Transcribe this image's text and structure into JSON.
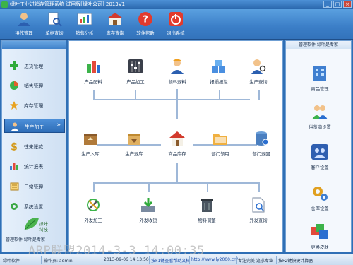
{
  "window": {
    "title": "绿叶工业进销存管理系统  试用版[绿叶公司]  2013V1",
    "minimize": "_",
    "maximize": "□",
    "close": "×"
  },
  "toolbar": {
    "items": [
      {
        "label": "操作管理",
        "icon": "user-manage-icon"
      },
      {
        "label": "单据查询",
        "icon": "document-search-icon"
      },
      {
        "label": "销售分析",
        "icon": "sales-analysis-icon"
      },
      {
        "label": "库存查询",
        "icon": "warehouse-icon"
      },
      {
        "label": "软件帮助",
        "icon": "help-icon"
      },
      {
        "label": "退出系统",
        "icon": "exit-icon"
      }
    ]
  },
  "sidebar": {
    "items": [
      {
        "label": "进货管理",
        "icon": "plus-icon",
        "color": "#2faa3a"
      },
      {
        "label": "销售管理",
        "icon": "pie-icon",
        "color": "#e2602c"
      },
      {
        "label": "库存管理",
        "icon": "star-icon",
        "color": "#e8a21f"
      },
      {
        "label": "生产加工",
        "icon": "user-icon",
        "color": "#ffffff",
        "active": true,
        "chevron": "»"
      },
      {
        "label": "往来账款",
        "icon": "dollar-icon",
        "color": "#d39a1b"
      },
      {
        "label": "统计报表",
        "icon": "bar-chart-icon",
        "color": "#3f7fd0"
      },
      {
        "label": "日常管理",
        "icon": "notebook-icon",
        "color": "#e1a321"
      },
      {
        "label": "系统设置",
        "icon": "gear-icon",
        "color": "#3ba845"
      }
    ],
    "logo_text": "绿叶科技",
    "caption": "管理软件 绿叶是专家"
  },
  "main": {
    "row1": [
      "产品配料",
      "产品加工",
      "领料退料",
      "报损报溢",
      "生产查询"
    ],
    "row2": [
      "生产入库",
      "生产退库",
      "商品库存",
      "部门领用",
      "部门退回"
    ],
    "row3": [
      "外发加工",
      "外发收货",
      "物料调整",
      "外发查询"
    ]
  },
  "right_panel": {
    "header": "管理软件 绿叶是专家",
    "items": [
      {
        "label": "商品管理",
        "icon": "building-icon"
      },
      {
        "label": "供货商设置",
        "icon": "people-icon"
      },
      {
        "label": "客户设置",
        "icon": "customers-icon"
      },
      {
        "label": "仓库设置",
        "icon": "warehouse-gear-icon"
      },
      {
        "label": "更换皮肤",
        "icon": "skin-icon"
      }
    ]
  },
  "statusbar": {
    "app": "绿叶软件",
    "operator_label": "操作员: admin",
    "datetime": "2013-09-06 14:13:50",
    "hint": "按F1键查看帮助文档",
    "url": "http://www.ly2000.cn/",
    "slogan": "专注完美 追求专业",
    "calc": "按F2键快捷计算器"
  },
  "watermark": "ARP联盟2014-3-3  14:00:35"
}
